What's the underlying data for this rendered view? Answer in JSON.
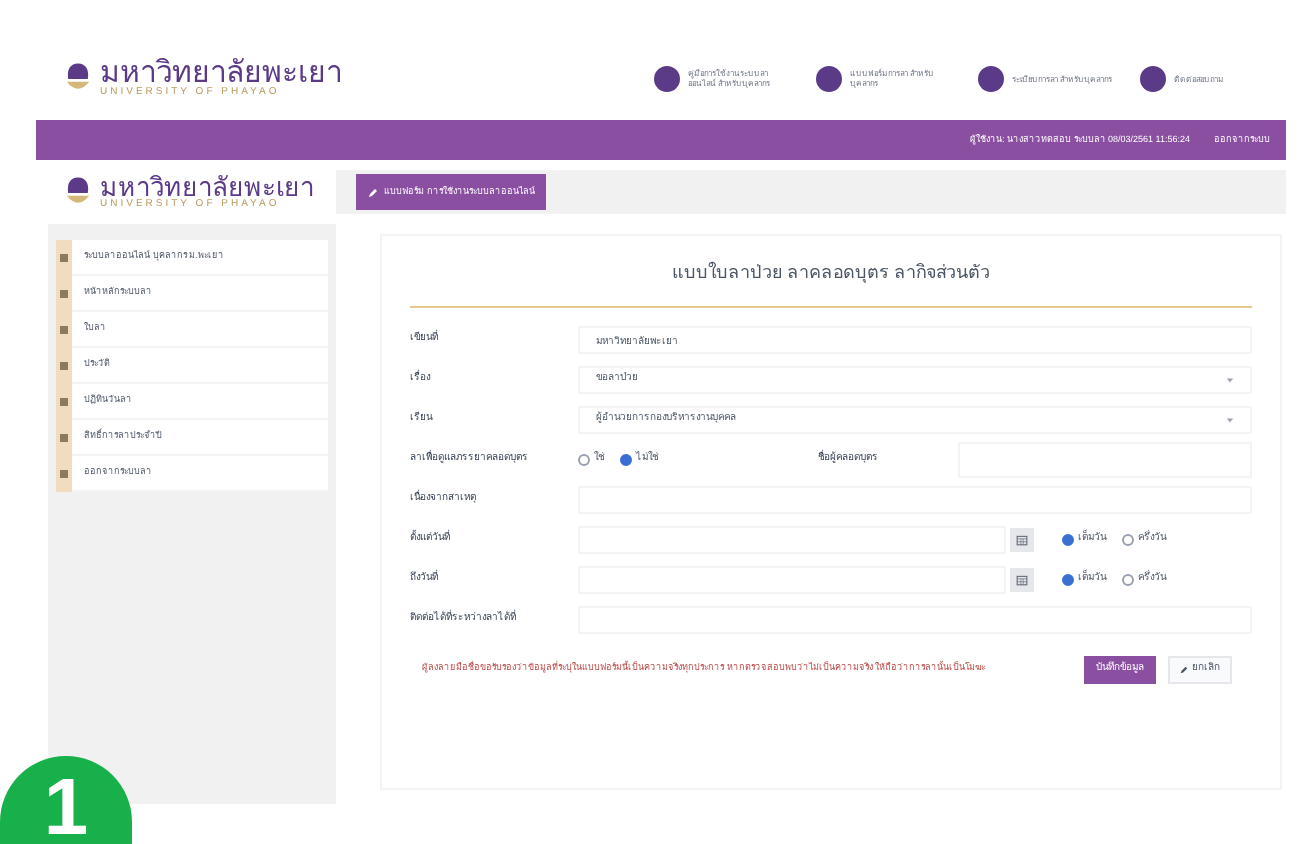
{
  "header": {
    "logo_thai": "มหาวิทยาลัยพะเยา",
    "logo_english": "UNIVERSITY OF PHAYAO",
    "links": [
      {
        "label": "คู่มือการใช้งานระบบลาออนไลน์ สำหรับบุคลากร"
      },
      {
        "label": "แบบฟอร์มการลา สำหรับบุคลากร"
      },
      {
        "label": "ระเบียบการลา สำหรับบุคลากร"
      },
      {
        "label": "ติดต่อสอบถาม"
      }
    ]
  },
  "top_bar": {
    "user_info": "ผู้ใช้งาน: นางสาวทดสอบ ระบบลา 08/03/2561 11:56:24",
    "logout": "ออกจากระบบ"
  },
  "sidebar": {
    "logo_thai": "มหาวิทยาลัยพะเยา",
    "logo_english": "UNIVERSITY OF PHAYAO",
    "items": [
      {
        "label": "ระบบลาออนไลน์ บุคลากร ม.พะเยา"
      },
      {
        "label": "หน้าหลักระบบลา"
      },
      {
        "label": "ใบลา"
      },
      {
        "label": "ประวัติ"
      },
      {
        "label": "ปฏิทินวันลา"
      },
      {
        "label": "สิทธิ์การลาประจำปี"
      },
      {
        "label": "ออกจากระบบลา"
      }
    ]
  },
  "tab": {
    "label": "แบบฟอร์ม การใช้งานระบบลาออนไลน์"
  },
  "form": {
    "title": "แบบใบลาป่วย ลาคลอดบุตร ลากิจส่วนตัว",
    "written_at": {
      "label": "เขียนที่",
      "value": "มหาวิทยาลัยพะเยา"
    },
    "subject": {
      "label": "เรื่อง",
      "value": "ขอลาป่วย"
    },
    "to": {
      "label": "เรียน",
      "value": "ผู้อำนวยการกองบริหารงานบุคคล"
    },
    "childbirth": {
      "label": "ลาเพื่อดูแลภรรยาคลอดบุตร",
      "options": [
        {
          "label": "ใช่",
          "selected": false
        },
        {
          "label": "ไม่ใช่",
          "selected": true
        }
      ],
      "name_label": "ชื่อผู้คลอดบุตร"
    },
    "reason": {
      "label": "เนื่องจากสาเหตุ"
    },
    "from_date": {
      "label": "ตั้งแต่วันที่",
      "options": [
        {
          "label": "เต็มวัน",
          "selected": true
        },
        {
          "label": "ครึ่งวัน",
          "selected": false
        }
      ]
    },
    "to_date": {
      "label": "ถึงวันที่",
      "options": [
        {
          "label": "เต็มวัน",
          "selected": true
        },
        {
          "label": "ครึ่งวัน",
          "selected": false
        }
      ]
    },
    "contact": {
      "label": "ติดต่อได้ที่ระหว่างลาได้ที่"
    },
    "note": "ผู้ลงลายมือชื่อขอรับรองว่าข้อมูลที่ระบุในแบบฟอร์มนี้เป็นความจริงทุกประการ หากตรวจสอบพบว่าไม่เป็นความจริง ให้ถือว่าการลานั้นเป็นโมฆะ",
    "save": "บันทึกข้อมูล",
    "cancel": "ยกเลิก"
  },
  "step_badge": "1"
}
